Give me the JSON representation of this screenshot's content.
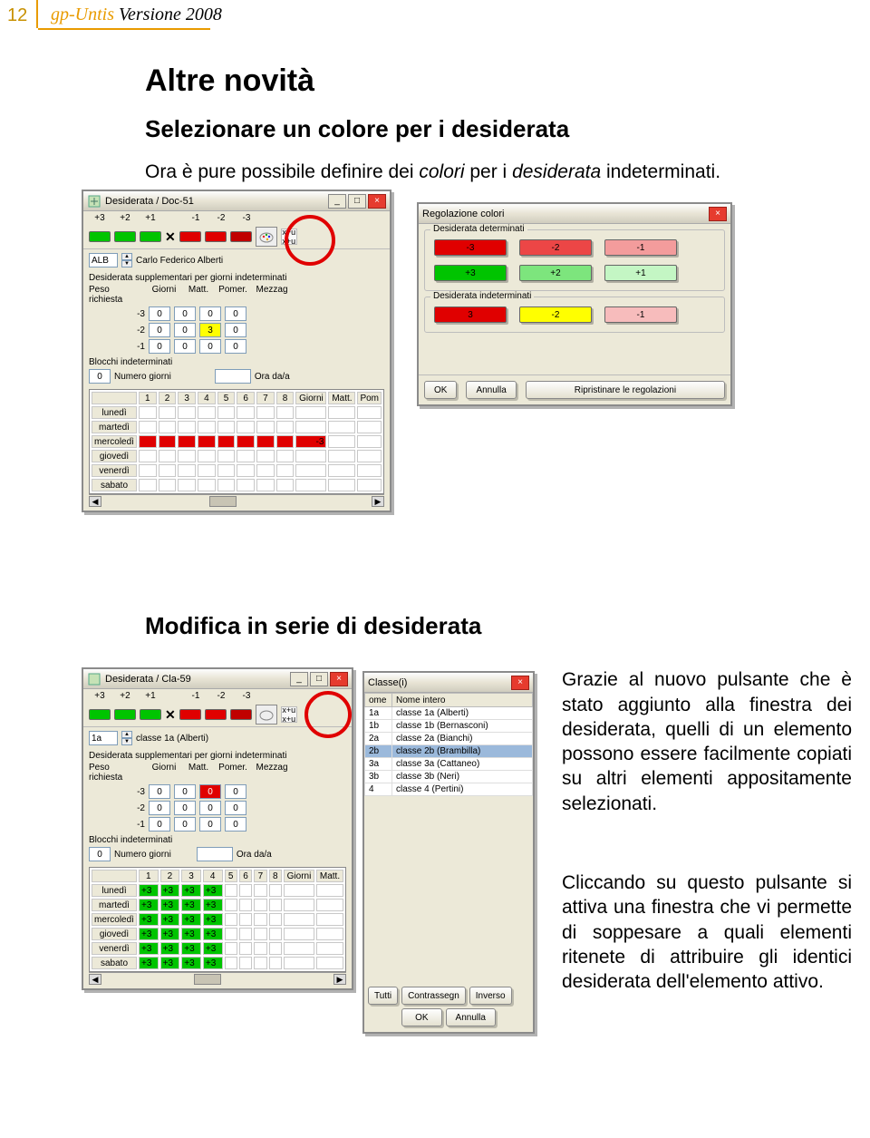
{
  "page_number": "12",
  "header": {
    "accent": "gp-Untis",
    "rest": " Versione 2008"
  },
  "headings": {
    "h1": "Altre novità",
    "h2a": "Selezionare un colore per i desiderata",
    "h2b": "Modifica in serie di desiderata"
  },
  "paragraphs": {
    "intro1a": "Ora è pure possibile definire dei ",
    "intro1b": "colori",
    "intro1c": " per i ",
    "intro1d": "desiderata",
    "intro1e": " indeterminati.",
    "p2": "Grazie al nuovo pulsante che è stato aggiunto alla finestra dei desiderata, quelli di un elemento possono essere facilmente copiati su altri elementi appositamente selezionati.",
    "p3": "Cliccando su questo pulsante si attiva una finestra che vi permette di soppesare a quali elementi ritenete di attribuire gli identici desiderata dell'elemento attivo."
  },
  "win1": {
    "title": "Desiderata / Doc-51",
    "priorities": [
      "+3",
      "+2",
      "+1",
      "-1",
      "-2",
      "-3"
    ],
    "code": "ALB",
    "codename": "Carlo Federico Alberti",
    "supLabel": "Desiderata supplementari per giorni indeterminati",
    "colHeads": [
      "Giorni",
      "Matt.",
      "Pomer.",
      "Mezzag"
    ],
    "pesoLabel": "Peso richiesta",
    "rows": [
      {
        "label": "-3",
        "cells": [
          "0",
          "0",
          "0",
          "0"
        ]
      },
      {
        "label": "-2",
        "cells": [
          "0",
          "0",
          "3",
          "0"
        ]
      },
      {
        "label": "-1",
        "cells": [
          "0",
          "0",
          "0",
          "0"
        ]
      }
    ],
    "blocchi": "Blocchi indeterminati",
    "numgiorni": "Numero giorni",
    "numgiorniVal": "0",
    "oradaa": "Ora da/a",
    "days": [
      "lunedì",
      "martedì",
      "mercoledì",
      "giovedì",
      "venerdì",
      "sabato"
    ],
    "gridCols": [
      "1",
      "2",
      "3",
      "4",
      "5",
      "6",
      "7",
      "8",
      "Giorni",
      "Matt.",
      "Pom"
    ]
  },
  "win2": {
    "title": "Regolazione colori",
    "group1": "Desiderata determinati",
    "detRow1": [
      {
        "label": "-3",
        "bg": "#e00000",
        "fg": "#000"
      },
      {
        "label": "-2",
        "bg": "#ec4646",
        "fg": "#000"
      },
      {
        "label": "-1",
        "bg": "#f39c9c",
        "fg": "#000"
      }
    ],
    "detRow2": [
      {
        "label": "+3",
        "bg": "#00c400",
        "fg": "#000"
      },
      {
        "label": "+2",
        "bg": "#7de57d",
        "fg": "#000"
      },
      {
        "label": "+1",
        "bg": "#c4f6c4",
        "fg": "#000"
      }
    ],
    "group2": "Desiderata indeterminati",
    "indRow": [
      {
        "label": "3",
        "bg": "#e00000",
        "fg": "#000"
      },
      {
        "label": "-2",
        "bg": "#ffff00",
        "fg": "#000"
      },
      {
        "label": "-1",
        "bg": "#f7bcbc",
        "fg": "#000"
      }
    ],
    "ok": "OK",
    "cancel": "Annulla",
    "reset": "Ripristinare le regolazioni"
  },
  "win3": {
    "title": "Desiderata / Cla-59",
    "priorities": [
      "+3",
      "+2",
      "+1",
      "-1",
      "-2",
      "-3"
    ],
    "code": "1a",
    "codename": "classe 1a (Alberti)",
    "supLabel": "Desiderata supplementari per giorni indeterminati",
    "colHeads": [
      "Giorni",
      "Matt.",
      "Pomer.",
      "Mezzag"
    ],
    "pesoLabel": "Peso richiesta",
    "rows": [
      {
        "label": "-3",
        "cells": [
          "0",
          "0",
          "0",
          "0"
        ]
      },
      {
        "label": "-2",
        "cells": [
          "0",
          "0",
          "0",
          "0"
        ]
      },
      {
        "label": "-1",
        "cells": [
          "0",
          "0",
          "0",
          "0"
        ]
      }
    ],
    "blocchi": "Blocchi indeterminati",
    "numgiorni": "Numero giorni",
    "numgiorniVal": "0",
    "oradaa": "Ora da/a",
    "days": [
      "lunedì",
      "martedì",
      "mercoledì",
      "giovedì",
      "venerdì",
      "sabato"
    ],
    "gridCols": [
      "1",
      "2",
      "3",
      "4",
      "5",
      "6",
      "7",
      "8",
      "Giorni",
      "Matt."
    ]
  },
  "win4": {
    "title": "Classe(i)",
    "col1": "ome",
    "col2": "Nome intero",
    "rows": [
      [
        "1a",
        "classe 1a (Alberti)"
      ],
      [
        "1b",
        "classe 1b (Bernasconi)"
      ],
      [
        "2a",
        "classe 2a (Bianchi)"
      ],
      [
        "2b",
        "classe 2b (Brambilla)"
      ],
      [
        "3a",
        "classe 3a (Cattaneo)"
      ],
      [
        "3b",
        "classe 3b (Neri)"
      ],
      [
        "4",
        "classe 4 (Pertini)"
      ]
    ],
    "btns": [
      "Tutti",
      "Contrassegn",
      "Inverso",
      "OK",
      "Annulla"
    ]
  }
}
